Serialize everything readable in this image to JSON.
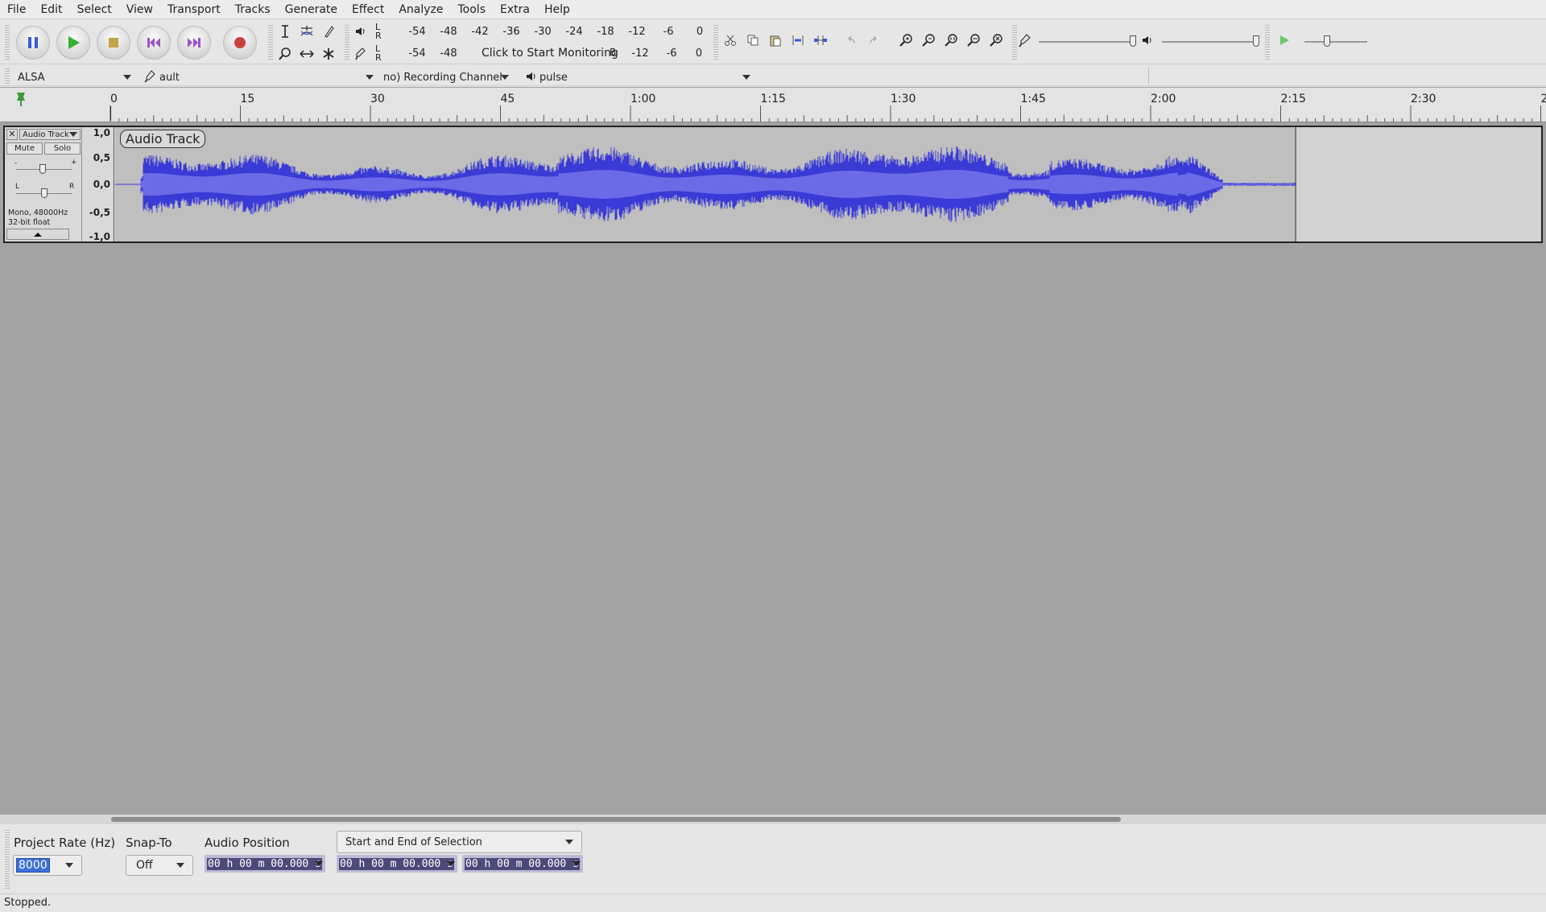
{
  "menu": [
    "File",
    "Edit",
    "Select",
    "View",
    "Transport",
    "Tracks",
    "Generate",
    "Effect",
    "Analyze",
    "Tools",
    "Extra",
    "Help"
  ],
  "meters": {
    "playback_ticks": [
      "-54",
      "-48",
      "-42",
      "-36",
      "-30",
      "-24",
      "-18",
      "-12",
      "-6",
      "0"
    ],
    "record_ticks_left": [
      "-54",
      "-48"
    ],
    "record_ticks_right": [
      "-12",
      "-6",
      "0"
    ],
    "record_message": "Click to Start Monitoring",
    "record_message_fragment": "B",
    "lr_l": "L",
    "lr_r": "R"
  },
  "device": {
    "host": "ALSA",
    "recording_device": "ault",
    "recording_channels": "no) Recording Channel",
    "playback_device": "pulse"
  },
  "ruler": {
    "labels": [
      "0",
      "15",
      "30",
      "45",
      "1:00",
      "1:15",
      "1:30",
      "1:45",
      "2:00",
      "2:15",
      "2:30",
      "2:45"
    ]
  },
  "track": {
    "name": "Audio Track",
    "mute": "Mute",
    "solo": "Solo",
    "gain_min": "-",
    "gain_max": "+",
    "pan_left": "L",
    "pan_right": "R",
    "info_line1": "Mono, 48000Hz",
    "info_line2": "32-bit float",
    "scale": [
      "1,0",
      "0,5",
      "0,0",
      "-0,5",
      "-1,0"
    ],
    "clip_label": "Audio Track",
    "wave_color": "#3a3ad6",
    "wave_rms_color": "#6b6be8"
  },
  "selection_toolbar": {
    "project_rate_label": "Project Rate (Hz)",
    "project_rate_value": "8000",
    "snap_to_label": "Snap-To",
    "snap_to_value": "Off",
    "audio_position_label": "Audio Position",
    "selection_mode": "Start and End of Selection",
    "audio_position_time": "00 h 00 m 00.000 s",
    "selection_start": "00 h 00 m 00.000 s",
    "selection_end": "00 h 00 m 00.000 s"
  },
  "status": "Stopped."
}
